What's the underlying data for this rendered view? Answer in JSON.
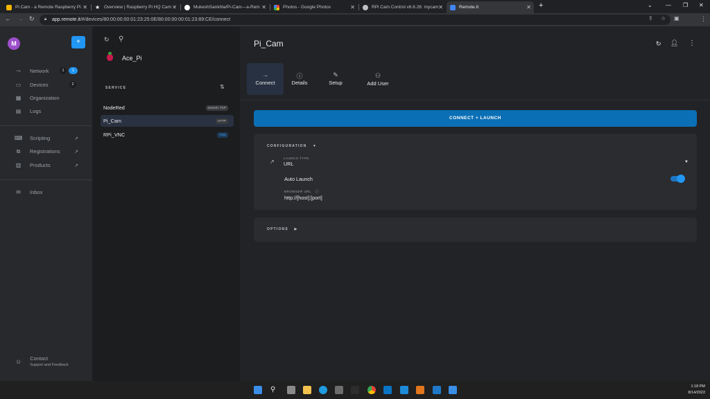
{
  "browser": {
    "tabs": [
      {
        "title": "Pi Cam - a Remote Raspberry Pi",
        "favicon_color": "#f4b400"
      },
      {
        "title": "Overview | Raspberry Pi HQ Cam",
        "favicon_color": "#ffffff"
      },
      {
        "title": "MukeshSankhla/Pi-Cam---a-Rem",
        "favicon_color": "#ffffff"
      },
      {
        "title": "Photos - Google Photos",
        "favicon_color": "#ea4335"
      },
      {
        "title": "RPi Cam Control v6.6.26: mycam",
        "favicon_color": "#bdc1c6"
      },
      {
        "title": "Remote.It",
        "favicon_color": "#4285f4"
      }
    ],
    "new_tab": "+",
    "url_host": "app.remote.it",
    "url_path": "/#/devices/80:00:00:00:01:23:25:0E/80:00:00:00:01:23:89:CE/connect"
  },
  "leftnav": {
    "avatar_letter": "M",
    "add_label": "+",
    "items": [
      {
        "label": "Network",
        "icon": "network-icon",
        "badge1": "1",
        "badge2": "1"
      },
      {
        "label": "Devices",
        "icon": "devices-icon",
        "badge1": "2"
      },
      {
        "label": "Organization",
        "icon": "organization-icon"
      },
      {
        "label": "Logs",
        "icon": "logs-icon"
      },
      {
        "label": "Scripting",
        "icon": "scripting-icon"
      },
      {
        "label": "Registrations",
        "icon": "registrations-icon"
      },
      {
        "label": "Products",
        "icon": "products-icon"
      },
      {
        "label": "Inbox",
        "icon": "inbox-icon"
      }
    ],
    "contact": {
      "title": "Contact",
      "subtitle": "Support and Feedback"
    }
  },
  "device": {
    "name": "Ace_Pi",
    "service_header": "SERVICE",
    "services": [
      {
        "name": "NodeRed",
        "tag": "Generic TCP"
      },
      {
        "name": "Pi_Cam",
        "tag": "HTTP"
      },
      {
        "name": "RPi_VNC",
        "tag": "VNC"
      }
    ]
  },
  "main": {
    "title": "Pi_Cam",
    "tabs": [
      {
        "label": "Connect"
      },
      {
        "label": "Details"
      },
      {
        "label": "Setup"
      },
      {
        "label": "Add User"
      }
    ],
    "launch_button": "CONNECT + LAUNCH",
    "configuration": {
      "header": "CONFIGURATION",
      "launch_type_label": "LAUNCH TYPE",
      "launch_type_value": "URL",
      "auto_launch_label": "Auto Launch",
      "auto_launch_on": true,
      "browser_url_label": "BROWSER URL",
      "browser_url_value": "http://[host]:[port]"
    },
    "options_header": "OPTIONS"
  },
  "taskbar": {
    "time": "1:18 PM",
    "date": "8/14/2022"
  },
  "colors": {
    "accent": "#2196f3",
    "launch_button": "#0b6fb5",
    "avatar": "#9c4fc9"
  }
}
